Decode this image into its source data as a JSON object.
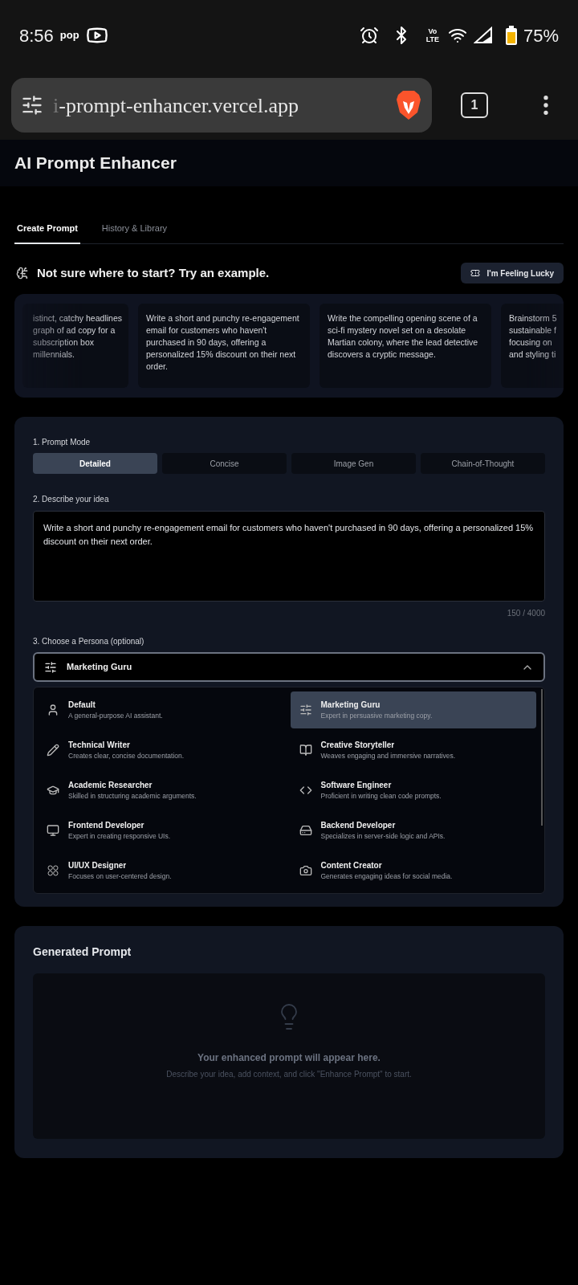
{
  "status_bar": {
    "time": "8:56",
    "app_badge": "pop",
    "network": "Vo LTE",
    "battery": "75%"
  },
  "browser": {
    "url_faded": "i",
    "url": "-prompt-enhancer.vercel.app",
    "tab_count": "1"
  },
  "app": {
    "title": "AI Prompt Enhancer"
  },
  "tabs": [
    {
      "label": "Create Prompt",
      "selected": true
    },
    {
      "label": "History & Library",
      "selected": false
    }
  ],
  "examples": {
    "heading": "Not sure where to start? Try an example.",
    "lucky_button": "I'm Feeling Lucky",
    "cards": [
      {
        "lines": [
          "istinct, catchy headlines",
          "graph of ad copy for a",
          "subscription box",
          "millennials."
        ],
        "kind": "clipped-start"
      },
      {
        "lines": [
          "Write a short and punchy re-engagement",
          "email for customers who haven't",
          "purchased in 90 days, offering a",
          "personalized 15% discount on their next",
          "order."
        ],
        "kind": "full"
      },
      {
        "lines": [
          "Write the compelling opening scene of a",
          "sci-fi mystery novel set on a desolate",
          "Martian colony, where the lead detective",
          "discovers a cryptic message."
        ],
        "kind": "full"
      },
      {
        "lines": [
          "Brainstorm 5",
          "sustainable f",
          "focusing on",
          "and styling ti"
        ],
        "kind": "clipped-end"
      }
    ]
  },
  "form": {
    "mode_label": "1. Prompt Mode",
    "modes": [
      {
        "label": "Detailed",
        "selected": true
      },
      {
        "label": "Concise",
        "selected": false
      },
      {
        "label": "Image Gen",
        "selected": false
      },
      {
        "label": "Chain-of-Thought",
        "selected": false
      }
    ],
    "idea_label": "2. Describe your idea",
    "idea_value": "Write a short and punchy re-engagement email for customers who haven't purchased in 90 days, offering a personalized 15% discount on their next order.",
    "char_count": "150 / 4000",
    "persona_label": "3. Choose a Persona (optional)",
    "persona_value": "Marketing Guru",
    "persona_expanded": true,
    "personas": [
      {
        "name": "Default",
        "description": "A general-purpose AI assistant.",
        "selected": false
      },
      {
        "name": "Marketing Guru",
        "description": "Expert in persuasive marketing copy.",
        "selected": true
      },
      {
        "name": "Technical Writer",
        "description": "Creates clear, concise documentation.",
        "selected": false
      },
      {
        "name": "Creative Storyteller",
        "description": "Weaves engaging and immersive narratives.",
        "selected": false
      },
      {
        "name": "Academic Researcher",
        "description": "Skilled in structuring academic arguments.",
        "selected": false
      },
      {
        "name": "Software Engineer",
        "description": "Proficient in writing clean code prompts.",
        "selected": false
      },
      {
        "name": "Frontend Developer",
        "description": "Expert in creating responsive UIs.",
        "selected": false
      },
      {
        "name": "Backend Developer",
        "description": "Specializes in server-side logic and APIs.",
        "selected": false
      },
      {
        "name": "UI/UX Designer",
        "description": "Focuses on user-centered design.",
        "selected": false
      },
      {
        "name": "Content Creator",
        "description": "Generates engaging ideas for social media.",
        "selected": false
      }
    ]
  },
  "output": {
    "title": "Generated Prompt",
    "empty_title": "Your enhanced prompt will appear here.",
    "empty_hint": "Describe your idea, add context, and click \"Enhance Prompt\" to start."
  }
}
